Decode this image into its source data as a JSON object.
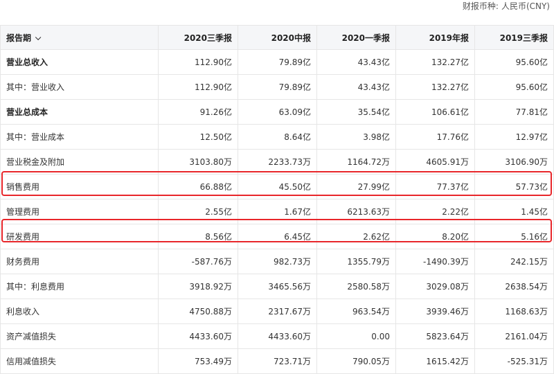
{
  "currency": {
    "label": "财报币种:",
    "value": "人民币(CNY)"
  },
  "table": {
    "period_label": "报告期",
    "columns": [
      "2020三季报",
      "2020中报",
      "2020一季报",
      "2019年报",
      "2019三季报"
    ],
    "rows": [
      {
        "label": "营业总收入",
        "bold": true,
        "values": [
          "112.90亿",
          "79.89亿",
          "43.43亿",
          "132.27亿",
          "95.60亿"
        ]
      },
      {
        "label": "其中：营业收入",
        "bold": false,
        "values": [
          "112.90亿",
          "79.89亿",
          "43.43亿",
          "132.27亿",
          "95.60亿"
        ]
      },
      {
        "label": "营业总成本",
        "bold": true,
        "values": [
          "91.26亿",
          "63.09亿",
          "35.54亿",
          "106.61亿",
          "77.81亿"
        ]
      },
      {
        "label": "其中：营业成本",
        "bold": false,
        "values": [
          "12.50亿",
          "8.64亿",
          "3.98亿",
          "17.76亿",
          "12.97亿"
        ]
      },
      {
        "label": "营业税金及附加",
        "bold": false,
        "values": [
          "3103.80万",
          "2233.73万",
          "1164.72万",
          "4605.91万",
          "3106.90万"
        ]
      },
      {
        "label": "销售费用",
        "bold": false,
        "values": [
          "66.88亿",
          "45.50亿",
          "27.99亿",
          "77.37亿",
          "57.73亿"
        ]
      },
      {
        "label": "管理费用",
        "bold": false,
        "values": [
          "2.55亿",
          "1.67亿",
          "6213.63万",
          "2.22亿",
          "1.45亿"
        ]
      },
      {
        "label": "研发费用",
        "bold": false,
        "values": [
          "8.56亿",
          "6.45亿",
          "2.62亿",
          "8.20亿",
          "5.16亿"
        ]
      },
      {
        "label": "财务费用",
        "bold": false,
        "values": [
          "-587.76万",
          "982.73万",
          "1355.79万",
          "-1490.39万",
          "242.15万"
        ]
      },
      {
        "label": "其中：利息费用",
        "bold": false,
        "values": [
          "3918.92万",
          "3465.56万",
          "2580.58万",
          "3029.08万",
          "2638.54万"
        ]
      },
      {
        "label": "利息收入",
        "bold": false,
        "values": [
          "4750.88万",
          "2317.67万",
          "963.54万",
          "3939.46万",
          "1168.63万"
        ]
      },
      {
        "label": "资产减值损失",
        "bold": false,
        "values": [
          "4433.60万",
          "4433.60万",
          "0.00",
          "5823.64万",
          "2161.04万"
        ]
      },
      {
        "label": "信用减值损失",
        "bold": false,
        "values": [
          "753.49万",
          "723.71万",
          "790.05万",
          "1615.42万",
          "-525.31万"
        ]
      }
    ]
  },
  "highlight_color": "#e8262a"
}
